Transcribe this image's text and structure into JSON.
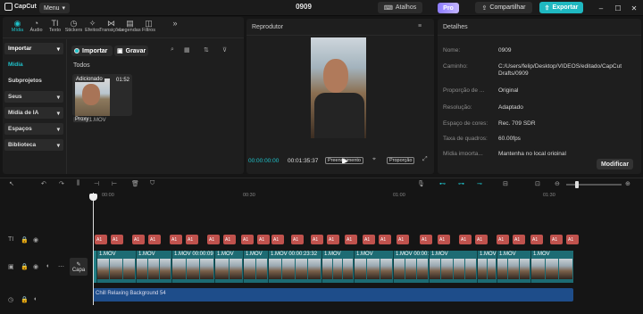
{
  "app": {
    "logo_text": "CapCut",
    "menu_label": "Menu",
    "project_title": "0909",
    "shortcuts_label": "Atalhos",
    "pro_label": "Pro",
    "share_label": "Compartilhar",
    "export_label": "Exportar"
  },
  "toolbar": {
    "items": [
      {
        "label": "Mídia",
        "icon": "media-icon",
        "active": true
      },
      {
        "label": "Áudio",
        "icon": "audio-icon"
      },
      {
        "label": "Texto",
        "icon": "text-icon"
      },
      {
        "label": "Stickers",
        "icon": "sticker-icon"
      },
      {
        "label": "Efeitos",
        "icon": "effects-icon"
      },
      {
        "label": "Transições",
        "icon": "transitions-icon"
      },
      {
        "label": "Legendas",
        "icon": "captions-icon"
      },
      {
        "label": "Filtros",
        "icon": "filters-icon"
      }
    ]
  },
  "media": {
    "import_label": "Importar",
    "record_label": "Gravar",
    "all_label": "Todos",
    "thumb_badge": "Adicionado",
    "thumb_duration": "01:52",
    "proxy_label": "Proxy",
    "file_name": "1.MOV"
  },
  "sidebar": {
    "items": [
      {
        "label": "Importar",
        "highlight": true
      },
      {
        "label": "Mídia",
        "active": true
      },
      {
        "label": "Subprojetos"
      },
      {
        "label": "Seus",
        "highlight": true
      },
      {
        "label": "Mídia de IA",
        "highlight": true
      },
      {
        "label": "Espaços",
        "highlight": true
      },
      {
        "label": "Biblioteca",
        "highlight": true
      }
    ]
  },
  "player": {
    "title": "Reprodutor",
    "current_time": "00:00:00:00",
    "total_time": "00:01:35:37",
    "fill_label": "Preenchimento",
    "ratio_label": "Proporção"
  },
  "details": {
    "title": "Detalhes",
    "rows": [
      {
        "k": "Nome:",
        "v": "0909"
      },
      {
        "k": "Caminho:",
        "v": "C:/Users/felip/Desktop/VIDEOS/editado/CapCut Drafts/0909"
      },
      {
        "k": "Proporção de ...",
        "v": "Original"
      },
      {
        "k": "Resolução:",
        "v": "Adaptado"
      },
      {
        "k": "Espaço de cores:",
        "v": "Rec. 709 SDR"
      },
      {
        "k": "Taxa de quadros:",
        "v": "60.00fps"
      },
      {
        "k": "Mídia importa...",
        "v": "Mantenha no local original"
      }
    ],
    "modify_label": "Modificar"
  },
  "timeline": {
    "ruler": [
      "00:00",
      "00:30",
      "01:00",
      "01:30"
    ],
    "cover_label": "Capa",
    "video_clip_label": "1.MOV",
    "audio_label": "Chill Relaxing Background 54",
    "clip_labels": [
      "1.MOV 00:00:09",
      "1.MOV 00:00:23:32",
      "1.MOV 00:00:18:54"
    ],
    "text_chip": "A1"
  },
  "colors": {
    "accent": "#1fc1c9",
    "video_track": "#237f86",
    "audio_track": "#1e4d8a",
    "text_chip": "#c0524d"
  }
}
